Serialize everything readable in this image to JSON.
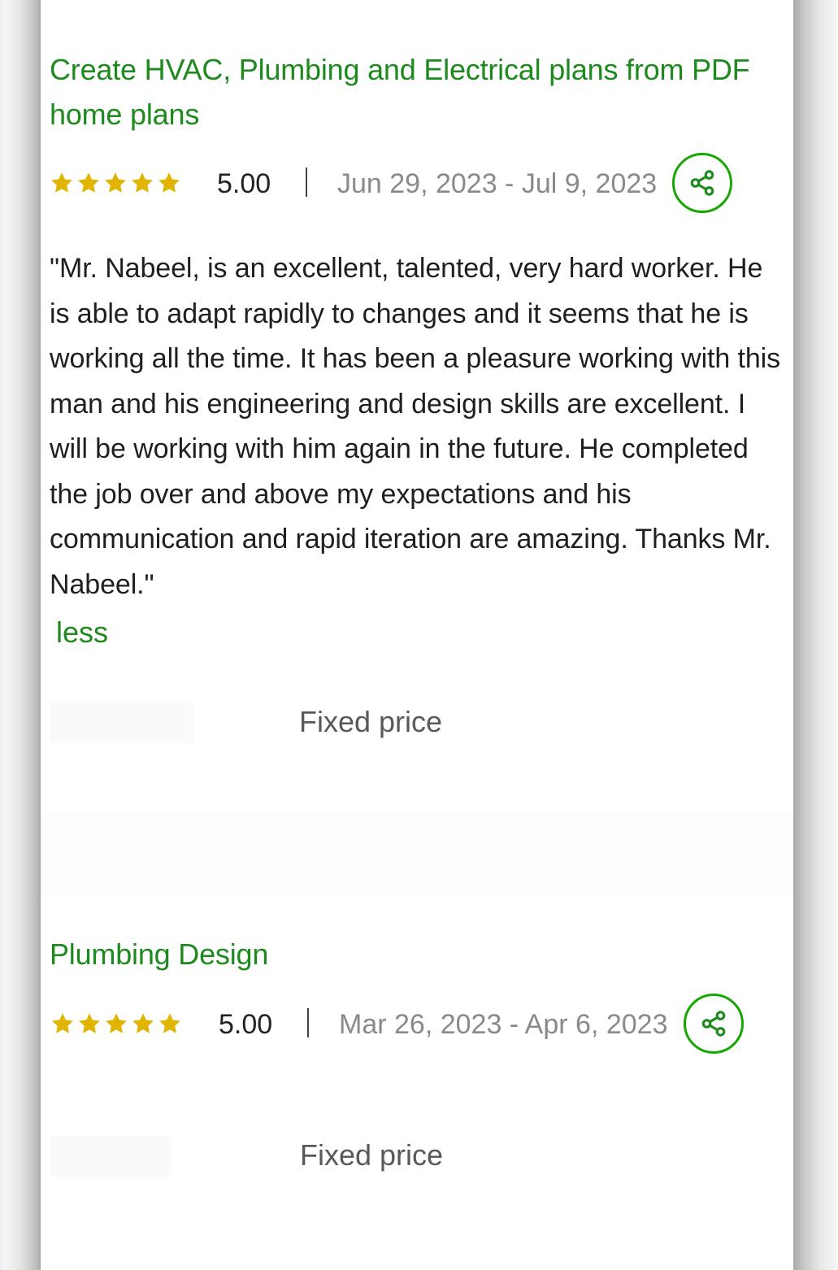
{
  "reviews": [
    {
      "title": "Create HVAC, Plumbing and Electrical plans from PDF home plans",
      "stars": 5,
      "rating": "5.00",
      "dates": "Jun 29, 2023 - Jul 9, 2023",
      "review": "\"Mr. Nabeel, is an excellent, talented, very hard worker. He is able to adapt rapidly to changes and it seems that he is working all the time. It has been a pleasure working with this man and his engineering and design skills are excellent. I will be working with him again in the future. He completed the job over and above my expectations and his communication and rapid iteration are amazing. Thanks Mr. Nabeel.\"",
      "less_label": "less",
      "contract_type": "Fixed price"
    },
    {
      "title": "Plumbing Design",
      "stars": 5,
      "rating": "5.00",
      "dates": "Mar 26, 2023 - Apr 6, 2023",
      "contract_type": "Fixed price"
    }
  ],
  "icons": {
    "star": "star-icon",
    "share": "share-icon"
  },
  "colors": {
    "accent_green": "#14a800",
    "title_green": "#1d8a1d",
    "star_gold": "#e0b400",
    "muted_text": "#8a8a8a"
  }
}
